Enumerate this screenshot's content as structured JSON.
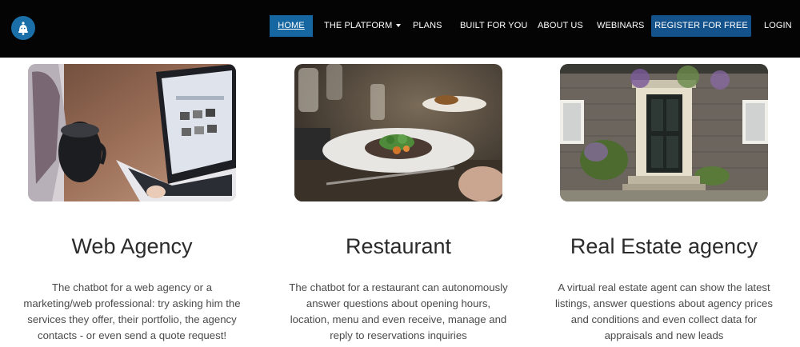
{
  "nav": {
    "logo_icon": "bell-bot-icon",
    "items": [
      {
        "label": "HOME",
        "active": true
      },
      {
        "label": "THE PLATFORM",
        "dropdown": true
      },
      {
        "label": "PLANS"
      },
      {
        "label": "BUILT FOR YOU"
      },
      {
        "label": "ABOUT US"
      },
      {
        "label": "WEBINARS"
      },
      {
        "label": "REGISTER FOR FREE",
        "cta": true
      },
      {
        "label": "LOGIN"
      }
    ],
    "colors": {
      "background": "#040404",
      "active": "#1566a1",
      "cta": "#14528c"
    }
  },
  "cards": [
    {
      "title": "Web Agency",
      "text": "The chatbot for a web agency or a marketing/web professional: try asking him the services they offer, their portfolio, the agency contacts - or even send a quote request!",
      "image_icon": "laptop-coffee-photo"
    },
    {
      "title": "Restaurant",
      "text": "The chatbot for a restaurant can autonomously answer questions about opening hours, location, menu and even receive, manage and reply to reservations inquiries",
      "image_icon": "restaurant-dish-photo"
    },
    {
      "title": "Real Estate agency",
      "text": "A virtual real estate agent can show the latest listings, answer questions about agency prices and conditions and even collect data for appraisals and new leads",
      "image_icon": "house-front-door-photo"
    }
  ]
}
